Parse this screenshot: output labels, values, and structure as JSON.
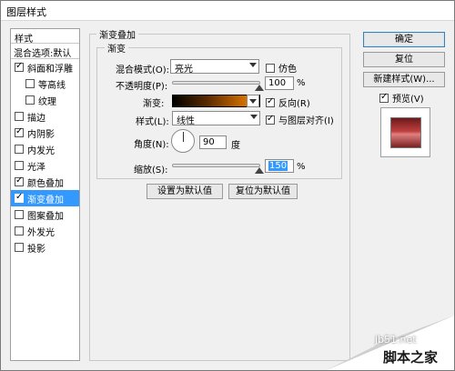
{
  "window": {
    "title": "图层样式"
  },
  "stylelist": {
    "header": "样式",
    "blend": "混合选项:默认",
    "items": [
      {
        "label": "斜面和浮雕",
        "checked": true,
        "sub": false,
        "selected": false
      },
      {
        "label": "等高线",
        "checked": false,
        "sub": true,
        "selected": false
      },
      {
        "label": "纹理",
        "checked": false,
        "sub": true,
        "selected": false
      },
      {
        "label": "描边",
        "checked": false,
        "sub": false,
        "selected": false
      },
      {
        "label": "内阴影",
        "checked": true,
        "sub": false,
        "selected": false
      },
      {
        "label": "内发光",
        "checked": false,
        "sub": false,
        "selected": false
      },
      {
        "label": "光泽",
        "checked": false,
        "sub": false,
        "selected": false
      },
      {
        "label": "颜色叠加",
        "checked": true,
        "sub": false,
        "selected": false
      },
      {
        "label": "渐变叠加",
        "checked": true,
        "sub": false,
        "selected": true
      },
      {
        "label": "图案叠加",
        "checked": false,
        "sub": false,
        "selected": false
      },
      {
        "label": "外发光",
        "checked": false,
        "sub": false,
        "selected": false
      },
      {
        "label": "投影",
        "checked": false,
        "sub": false,
        "selected": false
      }
    ]
  },
  "panel": {
    "title": "渐变叠加",
    "subtitle": "渐变",
    "blend_mode_label": "混合模式(O):",
    "blend_mode_value": "亮光",
    "dither_label": "仿色",
    "opacity_label": "不透明度(P):",
    "opacity_value": "100",
    "opacity_unit": "%",
    "gradient_label": "渐变:",
    "reverse_label": "反向(R)",
    "style_label": "样式(L):",
    "style_value": "线性",
    "align_label": "与图层对齐(I)",
    "angle_label": "角度(N):",
    "angle_value": "90",
    "angle_unit": "度",
    "scale_label": "缩放(S):",
    "scale_value": "150",
    "scale_unit": "%",
    "make_default": "设置为默认值",
    "reset_default": "复位为默认值",
    "dither_checked": false,
    "reverse_checked": true,
    "align_checked": true,
    "opacity_fraction": 1.0,
    "scale_fraction": 1.0
  },
  "buttons": {
    "ok": "确定",
    "reset": "复位",
    "new_style": "新建样式(W)...",
    "preview_label": "预览(V)",
    "preview_checked": true
  },
  "watermark": {
    "site": "jb51.net",
    "name": "脚本之家"
  }
}
